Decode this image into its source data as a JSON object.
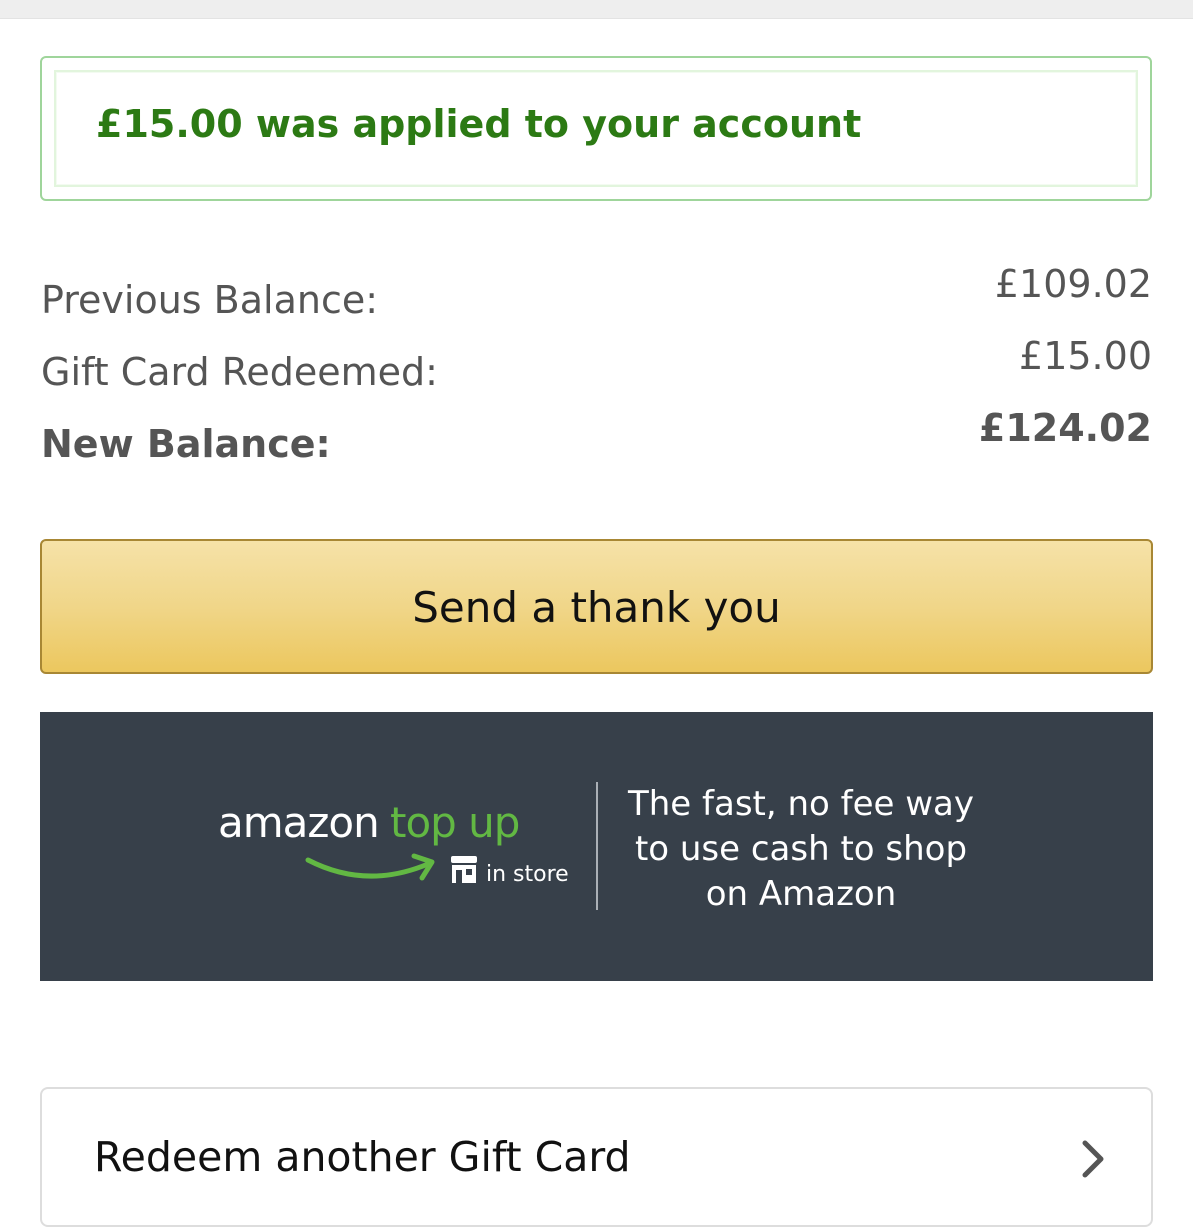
{
  "alert": {
    "message": "£15.00 was applied to your account"
  },
  "balance": {
    "rows": [
      {
        "label": "Previous Balance:",
        "value": "£109.02",
        "bold": false
      },
      {
        "label": "Gift Card Redeemed:",
        "value": "£15.00",
        "bold": false
      },
      {
        "label": "New Balance:",
        "value": "£124.02",
        "bold": true
      }
    ]
  },
  "thank_button": {
    "label": "Send a thank you"
  },
  "banner": {
    "logo_amazon": "amazon",
    "logo_topup": "top up",
    "logo_in_store": "in store",
    "tagline_lines": [
      "The fast, no fee way",
      "to use cash to shop",
      "on Amazon"
    ],
    "store_icon": "store-icon",
    "smile_icon": "amazon-smile-arrow"
  },
  "redeem_another": {
    "label": "Redeem another Gift Card",
    "icon": "chevron-right-icon"
  },
  "colors": {
    "success_text": "#2c7a14",
    "success_border": "#9fd59b",
    "button_gold": "#f0d689",
    "button_border": "#a88734",
    "banner_bg": "#37404a",
    "topup_green": "#62b843"
  }
}
